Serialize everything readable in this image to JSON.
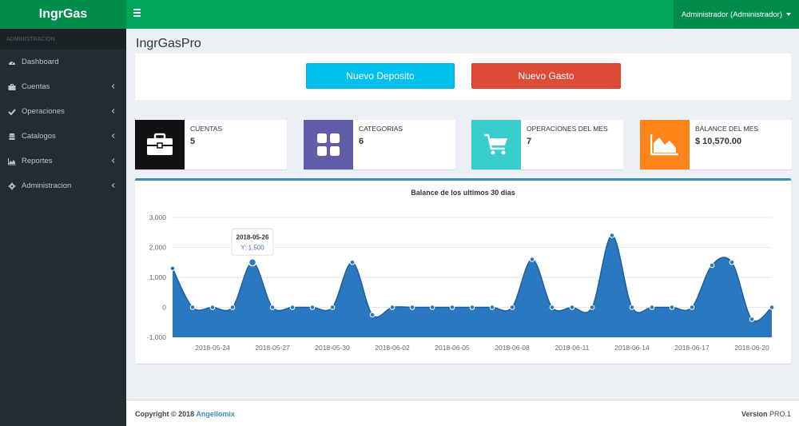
{
  "header": {
    "logo": "IngrGas",
    "user_menu": "Administrador (Administrador)"
  },
  "sidebar": {
    "section": "ADMINISTRACION",
    "items": [
      {
        "label": "Dashboard",
        "icon": "dashboard-icon"
      },
      {
        "label": "Cuentas",
        "icon": "briefcase-icon"
      },
      {
        "label": "Operaciones",
        "icon": "check-icon"
      },
      {
        "label": "Catalogos",
        "icon": "database-icon"
      },
      {
        "label": "Reportes",
        "icon": "area-chart-icon"
      },
      {
        "label": "Administracion",
        "icon": "gear-icon"
      }
    ]
  },
  "page": {
    "title": "IngrGasPro",
    "btn_deposit": "Nuevo Deposito",
    "btn_expense": "Nuevo Gasto"
  },
  "info_boxes": [
    {
      "label": "CUENTAS",
      "value": "5",
      "color": "#111111",
      "icon": "briefcase-icon"
    },
    {
      "label": "CATEGORIAS",
      "value": "6",
      "color": "#605ca8",
      "icon": "grid-icon"
    },
    {
      "label": "OPERACIONES DEL MES",
      "value": "7",
      "color": "#39cccc",
      "icon": "cart-icon"
    },
    {
      "label": "BALANCE DEL MES",
      "value": "$ 10,570.00",
      "color": "#ff851b",
      "icon": "area-chart-icon"
    }
  ],
  "chart_data": {
    "type": "area",
    "title": "Balance de los ultimos 30 dias",
    "ylim": [
      -1000,
      3000
    ],
    "yticks": [
      "3,000",
      "2,000",
      "1,000",
      "0",
      "-1,000"
    ],
    "xtick_labels": [
      "2018-05-24",
      "2018-05-27",
      "2018-05-30",
      "2018-06-02",
      "2018-06-05",
      "2018-06-08",
      "2018-06-11",
      "2018-06-14",
      "2018-06-17",
      "2018-06-20"
    ],
    "x": [
      "2018-05-22",
      "2018-05-23",
      "2018-05-24",
      "2018-05-25",
      "2018-05-26",
      "2018-05-27",
      "2018-05-28",
      "2018-05-29",
      "2018-05-30",
      "2018-05-31",
      "2018-06-01",
      "2018-06-02",
      "2018-06-03",
      "2018-06-04",
      "2018-06-05",
      "2018-06-06",
      "2018-06-07",
      "2018-06-08",
      "2018-06-09",
      "2018-06-10",
      "2018-06-11",
      "2018-06-12",
      "2018-06-13",
      "2018-06-14",
      "2018-06-15",
      "2018-06-16",
      "2018-06-17",
      "2018-06-18",
      "2018-06-19",
      "2018-06-20",
      "2018-06-21"
    ],
    "values": [
      1300,
      0,
      0,
      0,
      1500,
      0,
      0,
      0,
      0,
      1500,
      -250,
      0,
      0,
      0,
      0,
      0,
      0,
      0,
      1600,
      0,
      0,
      0,
      2400,
      0,
      0,
      0,
      0,
      1400,
      1500,
      -400,
      0,
      0
    ],
    "tooltip": {
      "date": "2018-05-26",
      "text": "Y: 1,500"
    },
    "color": "#2a78c0",
    "grid": true
  },
  "footer": {
    "copyright": "Copyright © 2018 ",
    "company": "Angellomix",
    "version_label": "Version",
    "version": "PRO.1"
  }
}
